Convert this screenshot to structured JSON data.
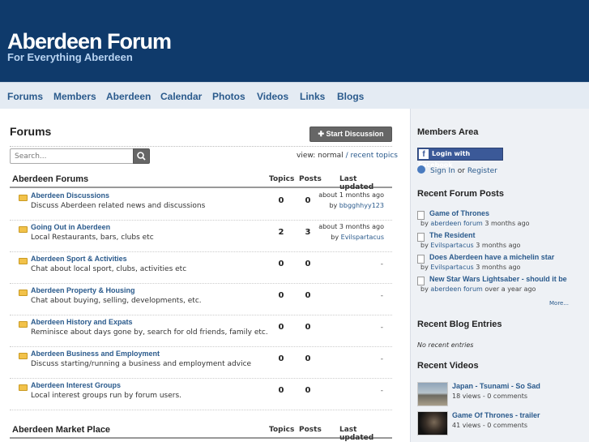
{
  "header": {
    "title": "Aberdeen Forum",
    "tagline": "For Everything Aberdeen"
  },
  "nav": [
    "Forums",
    "Members",
    "Aberdeen",
    "Calendar",
    "Photos",
    "Videos",
    "Links",
    "Blogs"
  ],
  "main": {
    "heading": "Forums",
    "start_button": "Start Discussion",
    "search_placeholder": "Search...",
    "view_label": "view:",
    "view_normal": "normal",
    "view_sep": "/",
    "view_recent": "recent topics",
    "sections": [
      {
        "title": "Aberdeen Forums",
        "col_topics": "Topics",
        "col_posts": "Posts",
        "col_updated": "Last updated"
      },
      {
        "title": "Aberdeen Market Place",
        "col_topics": "Topics",
        "col_posts": "Posts",
        "col_updated": "Last updated"
      }
    ],
    "forums": [
      {
        "name": "Aberdeen Discussions",
        "desc": "Discuss Aberdeen related news and discussions",
        "topics": "0",
        "posts": "0",
        "updated": "about 1 months ago",
        "by": "by",
        "user": "bbgghhyy123"
      },
      {
        "name": "Going Out in Aberdeen",
        "desc": "Local Restaurants, bars, clubs etc",
        "topics": "2",
        "posts": "3",
        "updated": "about 3 months ago",
        "by": "by",
        "user": "Evilspartacus"
      },
      {
        "name": "Aberdeen Sport & Activities",
        "desc": "Chat about local sport, clubs, activities etc",
        "topics": "0",
        "posts": "0",
        "dash": "-"
      },
      {
        "name": "Aberdeen Property & Housing",
        "desc": "Chat about buying, selling, developments, etc.",
        "topics": "0",
        "posts": "0",
        "dash": "-"
      },
      {
        "name": "Aberdeen History and Expats",
        "desc": "Reminisce about days gone by, search for old friends, family etc.",
        "topics": "0",
        "posts": "0",
        "dash": "-"
      },
      {
        "name": "Aberdeen Business and Employment",
        "desc": "Discuss starting/running a business and employment advice",
        "topics": "0",
        "posts": "0",
        "dash": "-"
      },
      {
        "name": "Aberdeen Interest Groups",
        "desc": "Local interest groups run by forum users.",
        "topics": "0",
        "posts": "0",
        "dash": "-"
      }
    ]
  },
  "sidebar": {
    "members_heading": "Members Area",
    "fb_login": "Login with Facebook",
    "fb_letter": "f",
    "sign_in": "Sign In",
    "or": "or",
    "register": "Register",
    "recent_posts_heading": "Recent Forum Posts",
    "recent_posts": [
      {
        "title": "Game of Thrones",
        "by": "by",
        "user": "aberdeen forum",
        "when": "3 months ago"
      },
      {
        "title": "The Resident",
        "by": "by",
        "user": "Evilspartacus",
        "when": "3 months ago"
      },
      {
        "title": "Does Aberdeen have a michelin star",
        "by": "by",
        "user": "Evilspartacus",
        "when": "3 months ago"
      },
      {
        "title": "New Star Wars Lightsaber - should it be",
        "by": "by",
        "user": "aberdeen forum",
        "when": "over a year ago"
      }
    ],
    "more": "More...",
    "blog_heading": "Recent Blog Entries",
    "no_entries": "No recent entries",
    "videos_heading": "Recent Videos",
    "videos": [
      {
        "title": "Japan - Tsunami - So Sad",
        "meta": "18 views - 0 comments"
      },
      {
        "title": "Game Of Thrones - trailer",
        "meta": "41 views - 0 comments"
      }
    ]
  }
}
